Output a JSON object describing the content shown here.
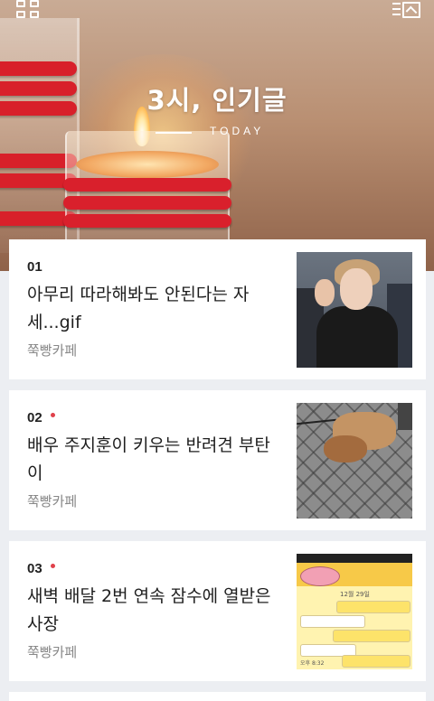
{
  "header": {
    "title": "3시, 인기글",
    "subtitle": "TODAY",
    "left_icon": "grid-icon",
    "right_icon": "list-view-icon"
  },
  "colors": {
    "accent_dot": "#e0414b",
    "candle_red": "#d8202a",
    "page_bg": "#eceef2"
  },
  "articles": [
    {
      "rank": "01",
      "is_new": false,
      "title": "아무리 따라해봐도 안된다는 자세...gif",
      "source": "쭉빵카페"
    },
    {
      "rank": "02",
      "is_new": true,
      "title": "배우 주지훈이 키우는 반려견 부탄이",
      "source": "쭉빵카페"
    },
    {
      "rank": "03",
      "is_new": true,
      "title": "새벽 배달 2번 연속 잠수에 열받은 사장",
      "source": "쭉빵카페"
    }
  ],
  "thumb3_text": {
    "date": "12월 29일",
    "time": "오후 8:32"
  }
}
